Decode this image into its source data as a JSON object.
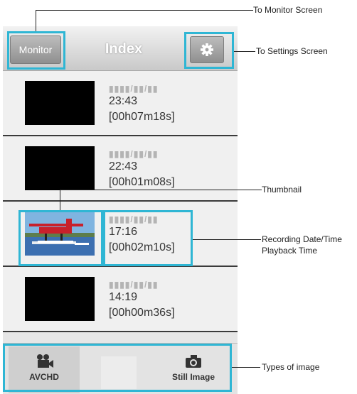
{
  "app": {
    "header": {
      "title": "Index",
      "monitor_label": "Monitor"
    },
    "rows": [
      {
        "date": "▮▮▮▮/▮▮/▮▮",
        "time": "23:43",
        "duration": "[00h07m18s]",
        "has_photo": false
      },
      {
        "date": "▮▮▮▮/▮▮/▮▮",
        "time": "22:43",
        "duration": "[00h01m08s]",
        "has_photo": false
      },
      {
        "date": "▮▮▮▮/▮▮/▮▮",
        "time": "17:16",
        "duration": "[00h02m10s]",
        "has_photo": true
      },
      {
        "date": "▮▮▮▮/▮▮/▮▮",
        "time": "14:19",
        "duration": "[00h00m36s]",
        "has_photo": false
      }
    ],
    "tabs": {
      "avchd_label": "AVCHD",
      "still_label": "Still Image"
    }
  },
  "annotations": {
    "monitor": "To Monitor Screen",
    "settings": "To Settings Screen",
    "thumbnail": "Thumbnail",
    "recording_line1": "Recording Date/Time",
    "recording_line2": "Playback Time",
    "types": "Types of image"
  },
  "icons": {
    "settings": "gear-icon",
    "avchd": "video-camera-icon",
    "still": "camera-icon"
  },
  "colors": {
    "highlight": "#2fb6d4",
    "header_text": "#ffffff",
    "thumbnail_bg": "#000000"
  }
}
